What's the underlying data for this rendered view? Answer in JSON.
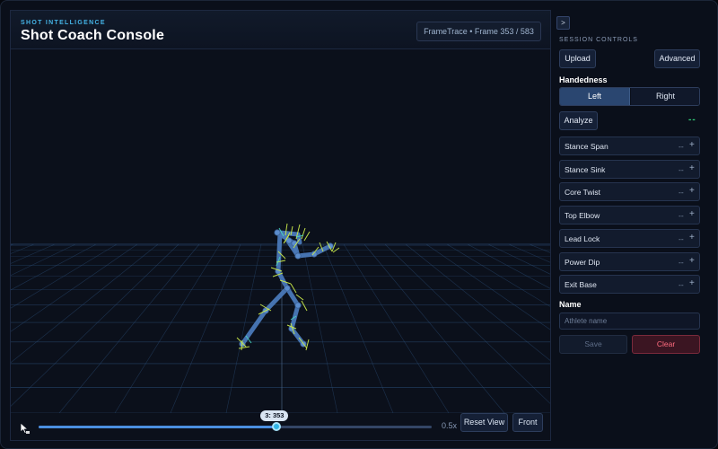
{
  "header": {
    "kicker": "SHOT INTELLIGENCE",
    "title": "Shot Coach Console",
    "frame_indicator": "FrameTrace • Frame 353 / 583"
  },
  "timeline": {
    "current_frame": 353,
    "total_frames": 583,
    "thumb_label": "3: 353",
    "speed": "0.5x",
    "reset_view_label": "Reset View",
    "front_label": "Front"
  },
  "panel": {
    "collapse_label": ">",
    "section_label": "SESSION CONTROLS",
    "upload_label": "Upload",
    "advanced_label": "Advanced",
    "handedness_label": "Handedness",
    "handedness_options": [
      "Left",
      "Right"
    ],
    "handedness_selected": "Left",
    "analyze_label": "Analyze",
    "status_indicator": "--",
    "metrics": [
      {
        "label": "Stance Span",
        "value": "--",
        "action": "+"
      },
      {
        "label": "Stance Sink",
        "value": "--",
        "action": "+"
      },
      {
        "label": "Core Twist",
        "value": "--",
        "action": "+"
      },
      {
        "label": "Top Elbow",
        "value": "--",
        "action": "+"
      },
      {
        "label": "Lead Lock",
        "value": "--",
        "action": "+"
      },
      {
        "label": "Power Dip",
        "value": "--",
        "action": "+"
      },
      {
        "label": "Exit Base",
        "value": "--",
        "action": "+"
      }
    ],
    "name_label": "Name",
    "name_placeholder": "Athlete name",
    "name_value": "",
    "save_label": "Save",
    "clear_label": "Clear"
  },
  "icons": {
    "cursor": "pointer-cursor-icon"
  },
  "colors": {
    "accent": "#45b4e6",
    "skeleton": "#4a79b8",
    "joint_axis": "#c9e84a",
    "grid": "#2b4e78",
    "status_ok": "#33d17a",
    "danger": "#ff6b7e"
  }
}
